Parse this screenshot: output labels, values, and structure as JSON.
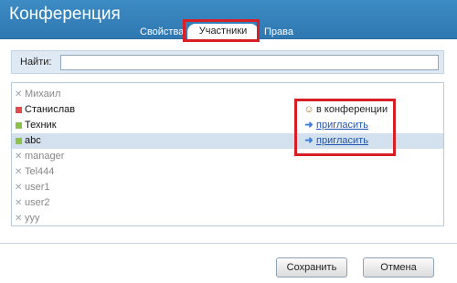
{
  "dialog": {
    "title": "Конференция",
    "tabs": [
      {
        "label": "Свойства"
      },
      {
        "label": "Участники",
        "active": true
      },
      {
        "label": "Права"
      }
    ]
  },
  "search": {
    "label": "Найти:",
    "value": ""
  },
  "participants": [
    {
      "name": "Михаил",
      "status": "offline",
      "status_icon": "x-mark-icon"
    },
    {
      "name": "Станислав",
      "status": "busy",
      "status_color": "#e04b4b",
      "action": "в конференции",
      "action_icon": "people-icon"
    },
    {
      "name": "Техник",
      "status": "online",
      "status_color": "#8bc34a",
      "action": "пригласить",
      "action_icon": "arrow-right-icon"
    },
    {
      "name": "abc",
      "status": "online",
      "status_color": "#8bc34a",
      "action": "пригласить",
      "action_icon": "arrow-right-icon",
      "selected": true
    },
    {
      "name": "manager",
      "status": "offline",
      "status_icon": "x-mark-icon"
    },
    {
      "name": "Tel444",
      "status": "offline",
      "status_icon": "x-mark-icon"
    },
    {
      "name": "user1",
      "status": "offline",
      "status_icon": "x-mark-icon"
    },
    {
      "name": "user2",
      "status": "offline",
      "status_icon": "x-mark-icon"
    },
    {
      "name": "yyy",
      "status": "offline",
      "status_icon": "x-mark-icon"
    }
  ],
  "buttons": {
    "save": "Сохранить",
    "cancel": "Отмена"
  },
  "colors": {
    "header": "#3d8bc4",
    "highlight": "#d91f26",
    "selected_row": "#d3e1ee",
    "link": "#1d55b3"
  }
}
